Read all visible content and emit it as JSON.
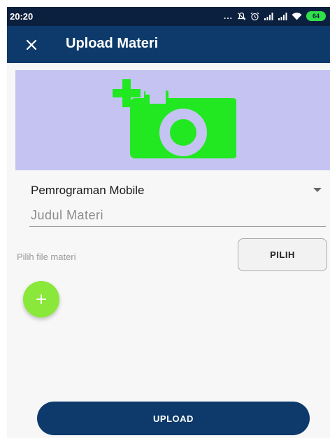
{
  "status_bar": {
    "time": "20:20",
    "icons": [
      "more-dots-icon",
      "notification-off-icon",
      "alarm-icon",
      "signal-1-icon",
      "signal-2-icon",
      "wifi-icon",
      "battery-icon"
    ],
    "more": "...",
    "battery_level": "64"
  },
  "app_bar": {
    "close_icon": "close-icon",
    "title": "Upload Materi"
  },
  "image_picker": {
    "icon": "add-photo-icon",
    "background_color": "#c4c3f2",
    "icon_color": "#22e822"
  },
  "form": {
    "course_spinner": {
      "selected": "Pemrograman Mobile",
      "icon": "dropdown-arrow-icon"
    },
    "title_input": {
      "value": "",
      "placeholder": "Judul Materi"
    },
    "file_label": "Pilih file materi",
    "pick_button_label": "PILIH",
    "fab_icon": "plus-icon"
  },
  "upload_button_label": "UPLOAD",
  "colors": {
    "primary": "#0d3a6b",
    "status_bar": "#0b1f3e",
    "fab": "#8ae83a",
    "battery": "#2fe04a"
  }
}
